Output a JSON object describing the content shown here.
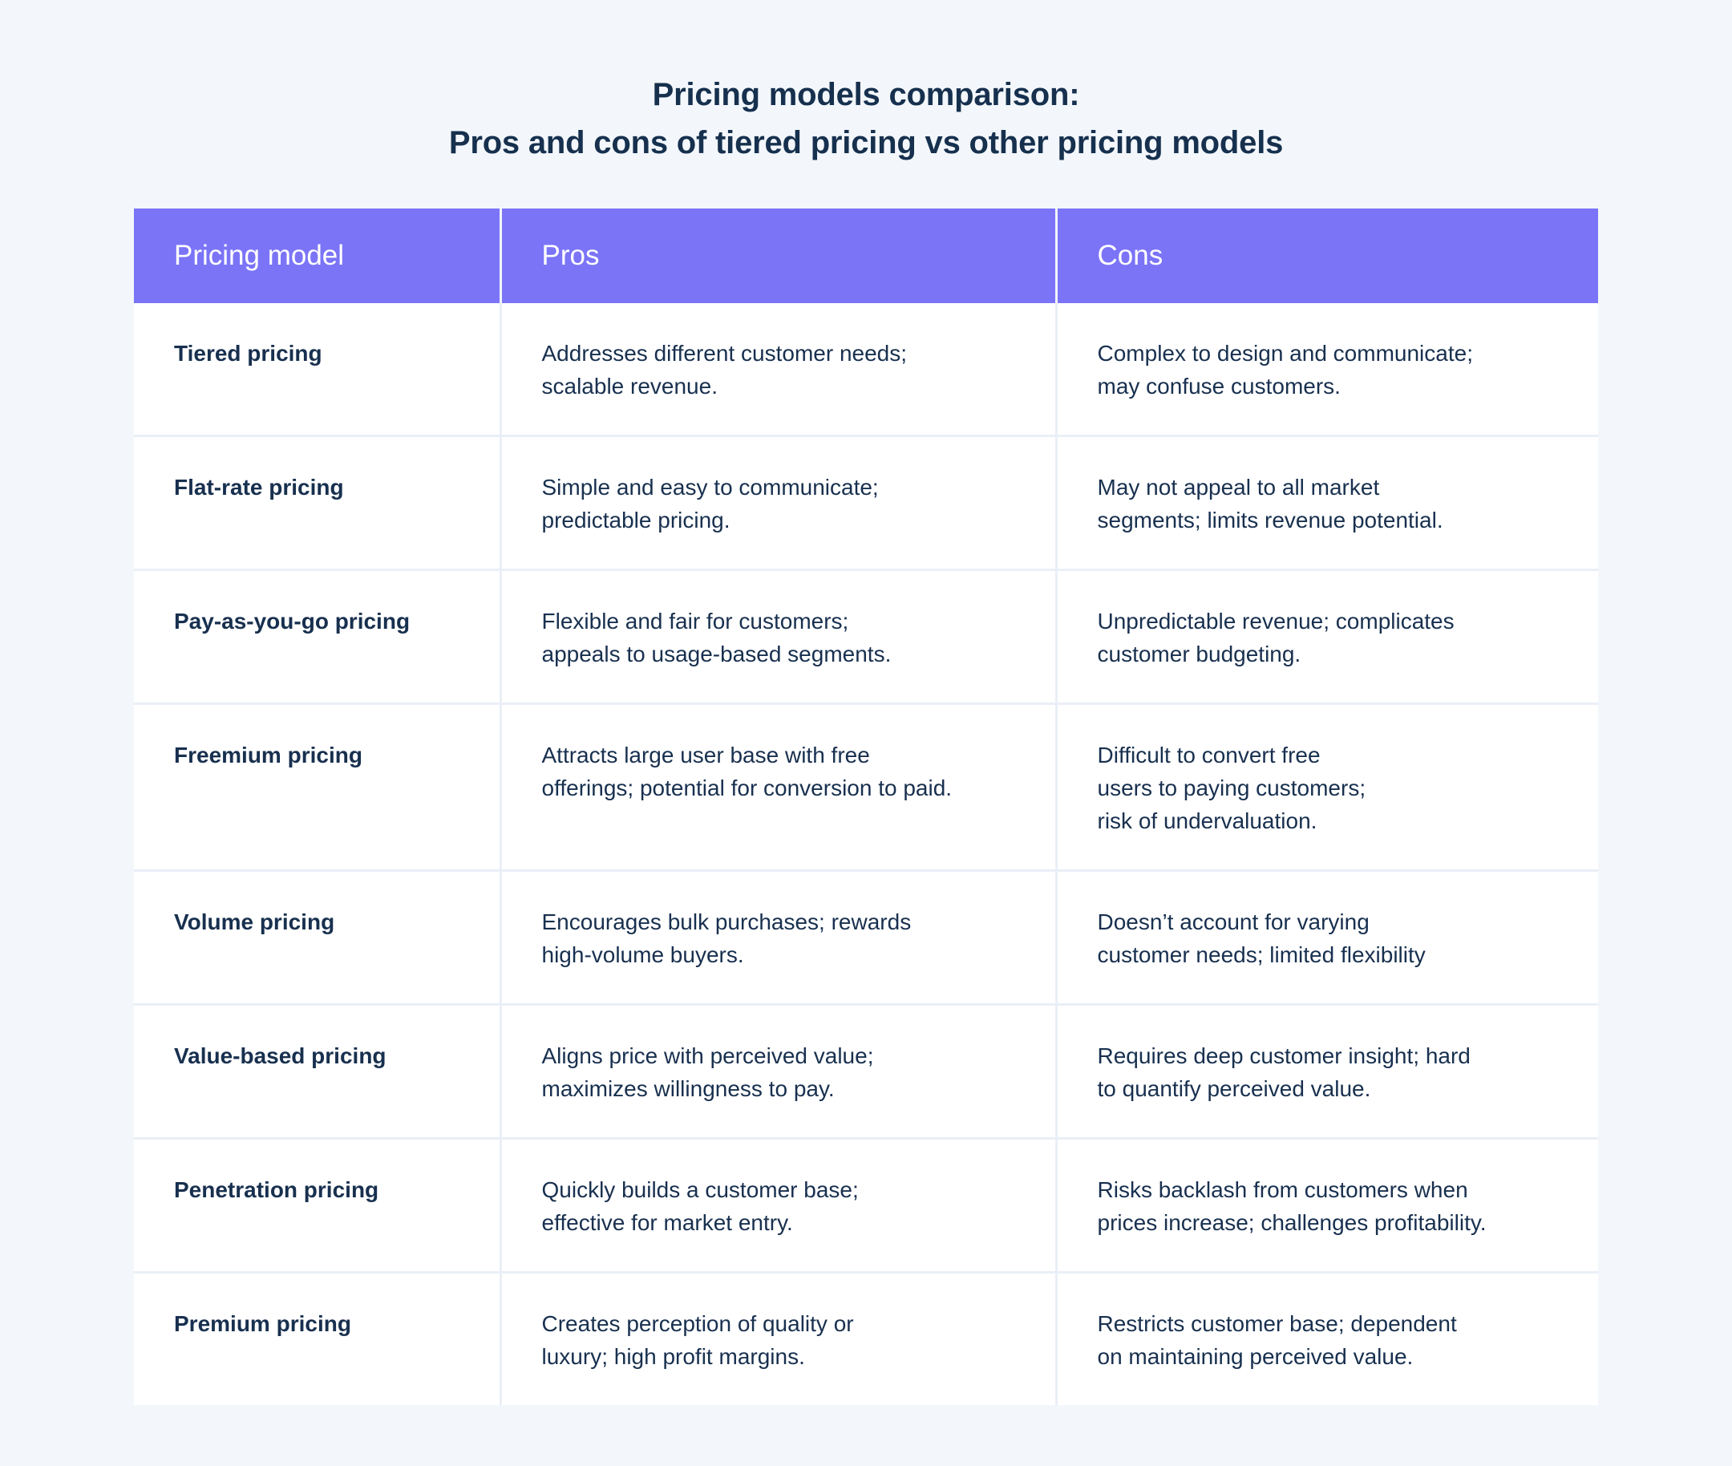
{
  "colors": {
    "page_background": "#f3f7fb",
    "header_accent": "#7b74f7",
    "text_dark": "#17304f",
    "header_text": "#ffffff",
    "grid_line": "#eaeff7",
    "cell_background": "#ffffff"
  },
  "title": {
    "line1": "Pricing models comparison:",
    "line2": "Pros and cons of tiered pricing vs other pricing models"
  },
  "table": {
    "columns": [
      "Pricing model",
      "Pros",
      "Cons"
    ],
    "rows": [
      {
        "model": "Tiered pricing",
        "pros": [
          "Addresses different customer needs;",
          "scalable revenue."
        ],
        "cons": [
          "Complex to design and communicate;",
          "may confuse customers."
        ]
      },
      {
        "model": "Flat-rate pricing",
        "pros": [
          "Simple and easy to communicate;",
          "predictable pricing."
        ],
        "cons": [
          "May not appeal to all market",
          "segments; limits revenue potential."
        ]
      },
      {
        "model": "Pay-as-you-go pricing",
        "pros": [
          "Flexible and fair for customers;",
          "appeals to usage-based segments."
        ],
        "cons": [
          "Unpredictable revenue; complicates",
          "customer budgeting."
        ]
      },
      {
        "model": "Freemium pricing",
        "pros": [
          "Attracts large user base with free",
          "offerings; potential for conversion to paid."
        ],
        "cons": [
          "Difficult to convert free",
          "users to paying customers;",
          "risk of undervaluation."
        ]
      },
      {
        "model": "Volume pricing",
        "pros": [
          "Encourages bulk purchases; rewards",
          "high-volume buyers."
        ],
        "cons": [
          "Doesn’t account for varying",
          "customer needs; limited flexibility"
        ]
      },
      {
        "model": "Value-based pricing",
        "pros": [
          "Aligns price with perceived value;",
          "maximizes willingness to pay."
        ],
        "cons": [
          "Requires deep customer insight; hard",
          "to quantify perceived value."
        ]
      },
      {
        "model": "Penetration pricing",
        "pros": [
          "Quickly builds a customer base;",
          "effective for market entry."
        ],
        "cons": [
          "Risks backlash from customers when",
          "prices increase; challenges profitability."
        ]
      },
      {
        "model": "Premium pricing",
        "pros": [
          "Creates perception of quality or",
          "luxury; high profit margins."
        ],
        "cons": [
          "Restricts customer base; dependent",
          "on maintaining perceived value."
        ]
      }
    ]
  }
}
